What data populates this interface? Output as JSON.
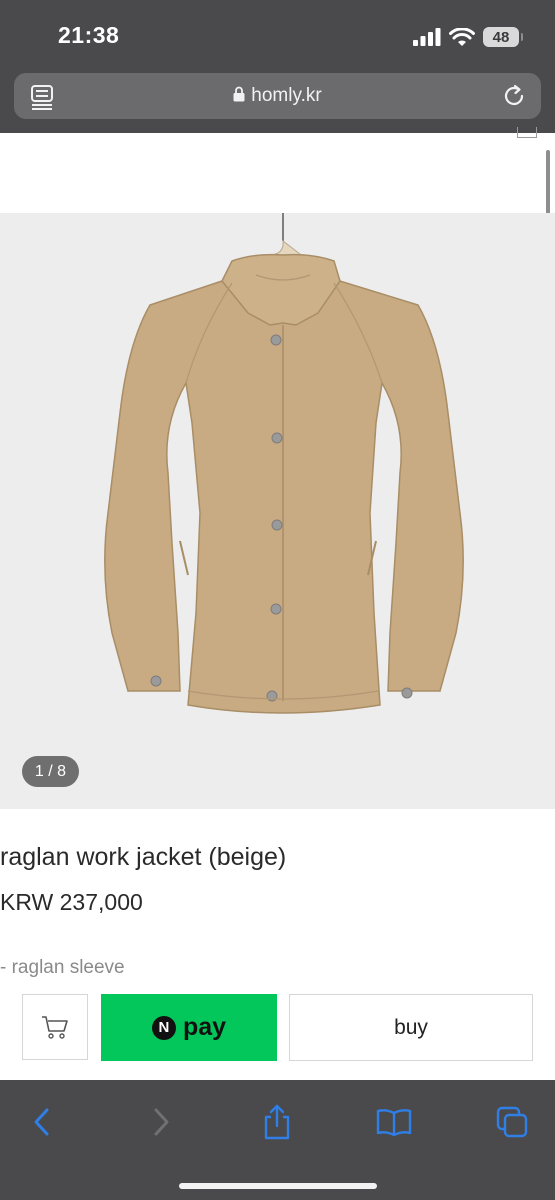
{
  "status_bar": {
    "time": "21:38",
    "battery": "48"
  },
  "browser": {
    "url": "homly.kr"
  },
  "product": {
    "image_counter": "1 / 8",
    "title": "raglan work jacket (beige)",
    "price": "KRW 237,000",
    "description_line": "- raglan sleeve"
  },
  "purchase_bar": {
    "npay_logo_letter": "N",
    "npay_label": "pay",
    "buy_label": "buy"
  },
  "colors": {
    "chrome": "#4a4a4c",
    "url_field": "#6b6b6e",
    "npay_green": "#03c75a",
    "toolbar_blue": "#2f7fe6",
    "photo_background": "#ededed",
    "jacket_beige": "#c8ab82"
  },
  "icons": [
    "reader-icon",
    "lock-icon",
    "reload-icon",
    "cart-icon",
    "back-icon",
    "forward-icon",
    "share-icon",
    "bookmarks-icon",
    "tabs-icon",
    "signal-icon",
    "wifi-icon"
  ]
}
